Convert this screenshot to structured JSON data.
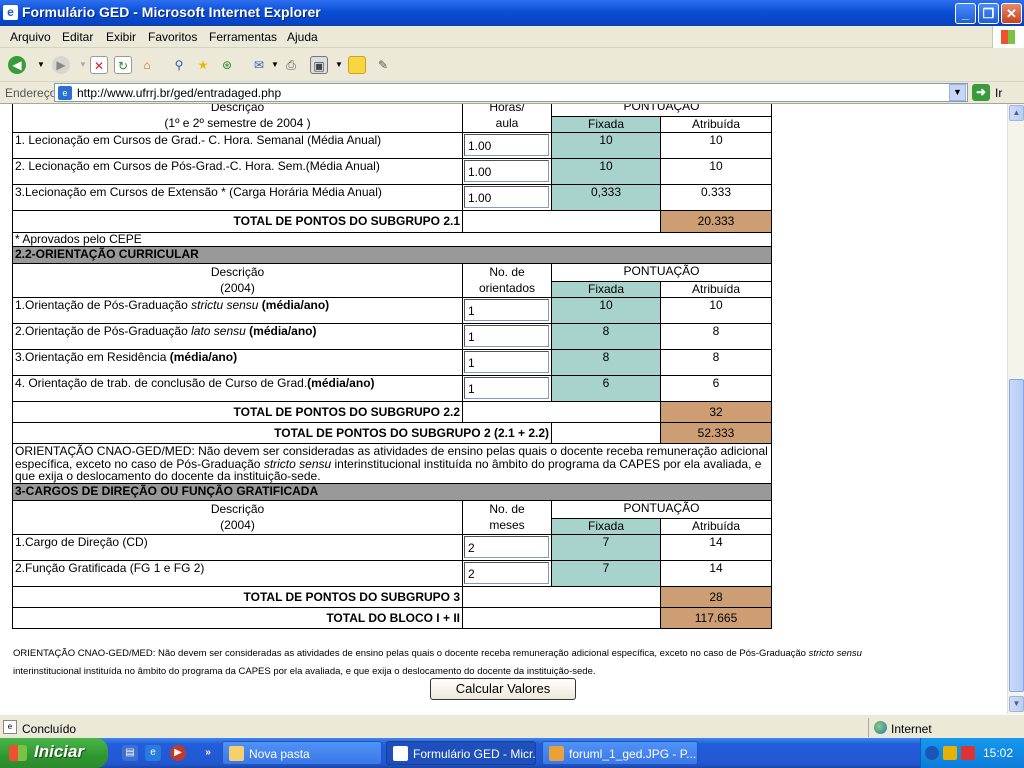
{
  "window": {
    "title": "Formulário GED - Microsoft Internet Explorer"
  },
  "menu": [
    "Arquivo",
    "Editar",
    "Exibir",
    "Favoritos",
    "Ferramentas",
    "Ajuda"
  ],
  "address": {
    "label": "Endereço",
    "url": "http://www.ufrrj.br/ged/entradaged.php",
    "go": "Ir"
  },
  "t1": {
    "desc_h1": "Descrição",
    "desc_h2": "(1º e 2º semestre de 2004 )",
    "hours_h1": "Horas/",
    "hours_h2": "aula",
    "pont": "PONTUAÇÃO",
    "fix": "Fixada",
    "atr": "Atribuída",
    "rows": [
      {
        "label": "1. Lecionação em Cursos de Grad.- C. Hora. Semanal (Média Anual)",
        "val": "1.00",
        "fix": "10",
        "atr": "10"
      },
      {
        "label": "2. Lecionação em Cursos de Pós-Grad.-C. Hora. Sem.(Média Anual)",
        "val": "1.00",
        "fix": "10",
        "atr": "10"
      },
      {
        "label": "3.Lecionação em Cursos de Extensão * (Carga Horária Média Anual)",
        "val": "1.00",
        "fix": "0,333",
        "atr": "0.333"
      }
    ],
    "total_label": "TOTAL DE PONTOS DO SUBGRUPO 2.1",
    "total": "20.333",
    "note": "* Aprovados pelo CEPE"
  },
  "t2": {
    "section": "2.2-ORIENTAÇÃO CURRICULAR",
    "desc_h1": "Descrição",
    "desc_h2": "(2004)",
    "count_h1": "No. de",
    "count_h2": "orientados",
    "pont": "PONTUAÇÃO",
    "fix": "Fixada",
    "atr": "Atribuída",
    "r1": {
      "a": "1.Orientação de Pós-Graduação ",
      "i": "strictu sensu",
      "b": " (média/ano)",
      "val": "1",
      "fix": "10",
      "atr": "10"
    },
    "r2": {
      "a": "2.Orientação de Pós-Graduação ",
      "i": "lato sensu",
      "b": " (média/ano)",
      "val": "1",
      "fix": "8",
      "atr": "8"
    },
    "r3": {
      "a": "3.Orientação em Residência ",
      "b": "(média/ano)",
      "val": "1",
      "fix": "8",
      "atr": "8"
    },
    "r4": {
      "a": "4. Orientação de trab. de conclusão de Curso de Grad.",
      "b": "(média/ano)",
      "val": "1",
      "fix": "6",
      "atr": "6"
    },
    "total22_label": "TOTAL DE PONTOS DO SUBGRUPO 2.2",
    "total22": "32",
    "total2_label": "TOTAL DE PONTOS DO SUBGRUPO 2 (2.1 + 2.2)",
    "total2": "52.333",
    "orient_a": "ORIENTAÇÃO CNAO-GED/MED: Não devem ser consideradas as atividades de ensino pelas quais o docente receba remuneração adicional específica, exceto no caso de Pós-Graduação ",
    "orient_i": "stricto sensu",
    "orient_b": " interinstitucional instituída no âmbito do programa da CAPES por ela avaliada, e que exija o deslocamento do docente da instituição-sede."
  },
  "t3": {
    "section": "3-CARGOS DE DIREÇÃO OU FUNÇÃO GRATIFICADA",
    "desc_h1": "Descrição",
    "desc_h2": "(2004)",
    "count_h1": "No. de",
    "count_h2": "meses",
    "pont": "PONTUAÇÃO",
    "fix": "Fixada",
    "atr": "Atribuída",
    "rows": [
      {
        "label": "1.Cargo de Direção (CD)",
        "val": "2",
        "fix": "7",
        "atr": "14"
      },
      {
        "label": "2.Função Gratificada (FG 1 e FG 2)",
        "val": "2",
        "fix": "7",
        "atr": "14"
      }
    ],
    "total3_label": "TOTAL DE PONTOS DO SUBGRUPO 3",
    "total3": "28",
    "totalb_label": "TOTAL DO BLOCO I + II",
    "totalb": "117.665"
  },
  "footer": {
    "a": "ORIENTAÇÃO CNAO-GED/MED: Não devem ser consideradas as atividades de ensino pelas quais o docente receba remuneração adicional específica, exceto no caso de Pós-Graduação ",
    "i": "stricto sensu",
    "b": "interinstitucional instituída no âmbito do programa da CAPES por ela avaliada, e que exija o deslocamento do docente da instituição-sede."
  },
  "button": "Calcular Valores",
  "status": {
    "text": "Concluído",
    "zone": "Internet"
  },
  "taskbar": {
    "start": "Iniciar",
    "tasks": [
      "Nova pasta",
      "Formulário GED - Micr...",
      "foruml_1_ged.JPG - P..."
    ],
    "clock": "15:02"
  },
  "colors": {
    "fixed": "#a8d3cd",
    "total": "#cd9e74",
    "section": "#999999"
  }
}
